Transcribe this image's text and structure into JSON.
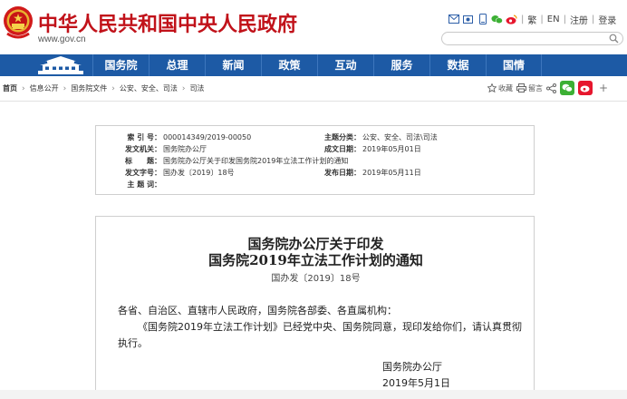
{
  "header": {
    "site_title": "中华人民共和国中央人民政府",
    "site_url": "www.gov.cn",
    "tools": {
      "icons": [
        "email-icon",
        "mobile-icon",
        "phone-icon",
        "wechat-icon",
        "weibo-icon"
      ],
      "lang_traditional": "繁",
      "lang_english": "EN",
      "register": "注册",
      "login": "登录"
    },
    "search": {
      "placeholder": ""
    },
    "brand_color": "#c1121a"
  },
  "nav": {
    "color": "#1d5aa5",
    "items": [
      "国务院",
      "总理",
      "新闻",
      "政策",
      "互动",
      "服务",
      "数据",
      "国情"
    ]
  },
  "breadcrumb": {
    "items": [
      "首页",
      "信息公开",
      "国务院文件",
      "公安、安全、司法",
      "司法"
    ]
  },
  "page_tools": {
    "favorite": "收藏",
    "print": "留言"
  },
  "meta": {
    "index_label": "索 引 号：",
    "index_value": "000014349/2019-00050",
    "category_label": "主题分类：",
    "category_value": "公安、安全、司法\\司法",
    "issuer_label": "发文机关：",
    "issuer_value": "国务院办公厅",
    "date_label": "成文日期：",
    "date_value": "2019年05月01日",
    "title_label": "标　　题：",
    "title_value": "国务院办公厅关于印发国务院2019年立法工作计划的通知",
    "docno_label": "发文字号：",
    "docno_value": "国办发〔2019〕18号",
    "pubdate_label": "发布日期：",
    "pubdate_value": "2019年05月11日",
    "keywords_label": "主 题 词：",
    "keywords_value": ""
  },
  "doc": {
    "title_line1": "国务院办公厅关于印发",
    "title_line2": "国务院2019年立法工作计划的通知",
    "number": "国办发〔2019〕18号",
    "salutation": "各省、自治区、直辖市人民政府，国务院各部委、各直属机构：",
    "para1_line1": "《国务院2019年立法工作计划》已经党中央、国务院同意，现印发给你们，请认真贯彻",
    "para1_line2": "执行。",
    "signer": "国务院办公厅",
    "sign_date": "2019年5月1日"
  }
}
